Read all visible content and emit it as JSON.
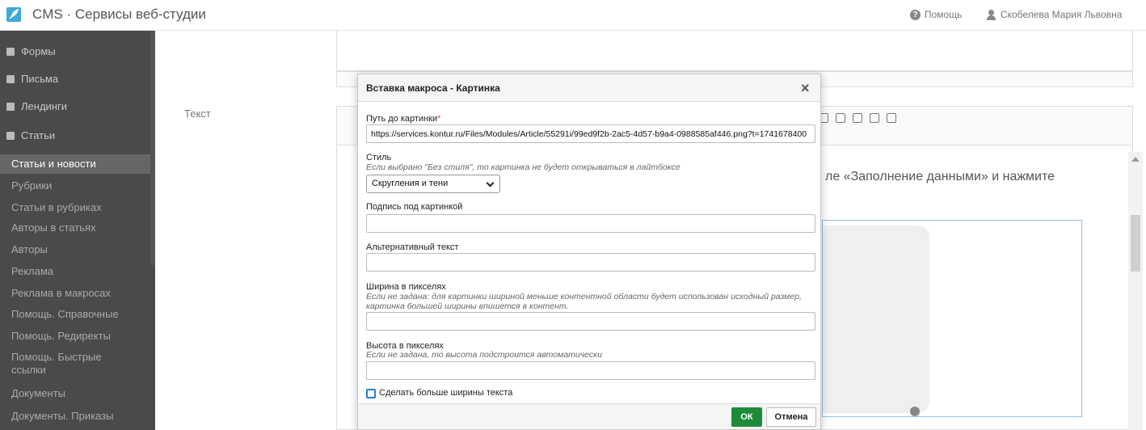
{
  "app": {
    "title": "CMS · Сервисы веб-студии",
    "logo_icon": "feather-icon"
  },
  "header": {
    "help": "Помощь",
    "user": "Скобелева Мария Львовна"
  },
  "sidebar": {
    "sections": [
      {
        "label": "Формы",
        "icon": "form-icon"
      },
      {
        "label": "Письма",
        "icon": "mail-icon"
      },
      {
        "label": "Лендинги",
        "icon": "filter-icon"
      },
      {
        "label": "Статьи",
        "icon": "article-icon"
      }
    ],
    "items": [
      {
        "label": "Статьи и новости",
        "active": true
      },
      {
        "label": "Рубрики"
      },
      {
        "label": "Статьи в рубриках"
      },
      {
        "label": "Авторы в статьях"
      },
      {
        "label": "Авторы"
      },
      {
        "label": "Реклама"
      },
      {
        "label": "Реклама в макросах"
      },
      {
        "label": "Помощь. Справочные"
      },
      {
        "label": "Помощь. Редиректы"
      },
      {
        "label": "Помощь. Быстрые ссылки"
      },
      {
        "label": "Документы"
      },
      {
        "label": "Документы. Приказы"
      }
    ]
  },
  "main": {
    "text_label": "Текст",
    "editor_text": "ле «Заполнение данными» и нажмите"
  },
  "modal": {
    "title": "Вставка макроса - Картинка",
    "path_label": "Путь до картинки",
    "path_required": "*",
    "path_value": "https://services.kontur.ru/Files/Modules/Article/55291i/99ed9f2b-2ac5-4d57-b9a4-0988585af446.png?t=1741678400",
    "style_label": "Стиль",
    "style_hint": "Если выбрано \"Без стиля\", то картинка не будет открываться в лайтбоксе",
    "style_value": "Скругления и тени",
    "caption_label": "Подпись под картинкой",
    "caption_value": "",
    "alt_label": "Альтернативный текст",
    "alt_value": "",
    "width_label": "Ширина в пикселях",
    "width_hint": "Если не задана: для картинки шириной меньше контентной области будет использован исходный размер, картинка большей ширины впишется в контент.",
    "width_value": "",
    "height_label": "Высота в пикселях",
    "height_hint": "Если не задана, то высота подстроится автоматически",
    "height_value": "",
    "wider_label": "Сделать больше ширины текста",
    "ok": "ОК",
    "cancel": "Отмена"
  },
  "colors": {
    "ok_button": "#1e8a3a",
    "sidebar_bg": "#4a4a4a",
    "required": "#d9534f",
    "logo": "#3fa9d9"
  }
}
